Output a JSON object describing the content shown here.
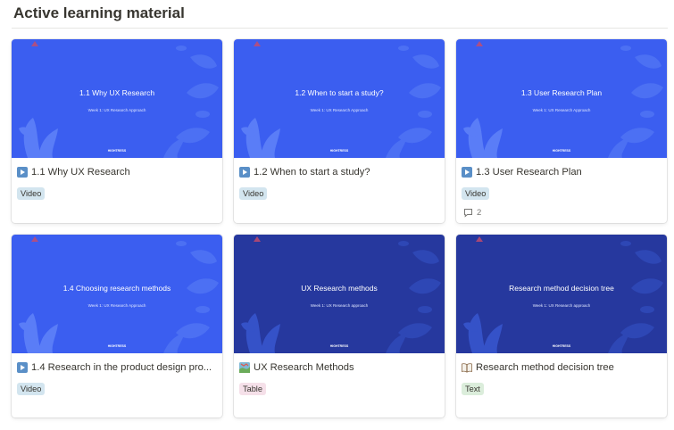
{
  "header": {
    "title": "Active learning material"
  },
  "colors": {
    "thumb_bright": "#3b5ef0",
    "thumb_dark": "#26389e",
    "tag_video": "#d3e5ef",
    "tag_table": "#f5e0e9",
    "tag_text": "#dbeddb"
  },
  "cards": [
    {
      "thumb_title": "1.1 Why UX Research",
      "thumb_sub": "Week 1: UX Research Approach",
      "thumb_logo": "HIGHTRESS",
      "title": "1.1 Why UX Research",
      "icon": "play-icon",
      "tag": "Video",
      "comments": ""
    },
    {
      "thumb_title": "1.2 When to start a study?",
      "thumb_sub": "Week 1: UX Research Approach",
      "thumb_logo": "HIGHTRESS",
      "title": "1.2 When to start a study?",
      "icon": "play-icon",
      "tag": "Video",
      "comments": ""
    },
    {
      "thumb_title": "1.3 User Research Plan",
      "thumb_sub": "Week 1: UX Research Approach",
      "thumb_logo": "HIGHTRESS",
      "title": "1.3 User Research Plan",
      "icon": "play-icon",
      "tag": "Video",
      "comments": "2"
    },
    {
      "thumb_title": "1.4 Choosing research methods",
      "thumb_sub": "Week 1: UX Research Approach",
      "thumb_logo": "HIGHTRESS",
      "title": "1.4 Research in the product design pro...",
      "icon": "play-icon",
      "tag": "Video",
      "comments": ""
    },
    {
      "thumb_title": "UX Research methods",
      "thumb_sub": "Week 1: UX Research approach",
      "thumb_logo": "HIGHTRESS",
      "title": "UX Research Methods",
      "icon": "map-icon",
      "tag": "Table",
      "comments": ""
    },
    {
      "thumb_title": "Research method decision tree",
      "thumb_sub": "Week 1: UX Research approach",
      "thumb_logo": "HIGHTRESS",
      "title": "Research method decision tree",
      "icon": "book-icon",
      "tag": "Text",
      "comments": ""
    }
  ]
}
